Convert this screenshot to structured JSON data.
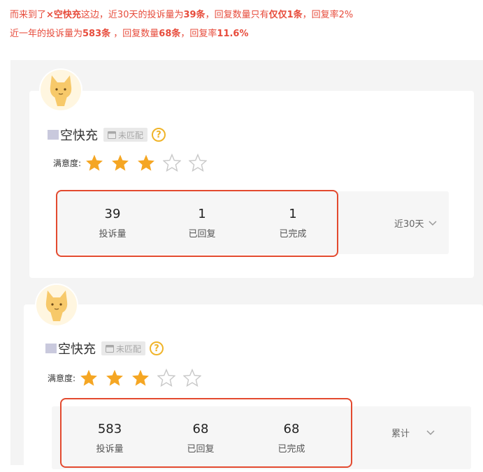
{
  "intro": {
    "line1": {
      "p1": "而来到了",
      "name": "×空快充",
      "p2": "这边，近30天的投诉量为",
      "count": "39条",
      "p3": "，回复数量只有",
      "replies": "仅仅1条",
      "p4": "，回复率2%"
    },
    "line2": {
      "p1": "近一年的投诉量为",
      "count": "583条",
      "p2": " ，回复数量",
      "replies": "68条",
      "p3": "，回复率",
      "rate": "11.6%"
    }
  },
  "cards": [
    {
      "name": "空快充",
      "badge": "未匹配",
      "help": "?",
      "rating_label": "满意度:",
      "rating": 3,
      "rating_max": 5,
      "stats": [
        {
          "value": "39",
          "label": "投诉量"
        },
        {
          "value": "1",
          "label": "已回复"
        },
        {
          "value": "1",
          "label": "已完成"
        }
      ],
      "period": "近30天"
    },
    {
      "name": "空快充",
      "badge": "未匹配",
      "help": "?",
      "rating_label": "满意度:",
      "rating": 3,
      "rating_max": 5,
      "stats": [
        {
          "value": "583",
          "label": "投诉量"
        },
        {
          "value": "68",
          "label": "已回复"
        },
        {
          "value": "68",
          "label": "已完成"
        }
      ],
      "period": "累计"
    }
  ],
  "colors": {
    "accent_red": "#e74c3c",
    "box_red": "#e34a2f",
    "star": "#f5a623",
    "help": "#f0b429"
  },
  "icons": {
    "avatar": "cat-avatar-icon",
    "badge": "card-icon",
    "help": "question-icon",
    "star": "star-icon",
    "dropdown": "chevron-down-icon"
  }
}
